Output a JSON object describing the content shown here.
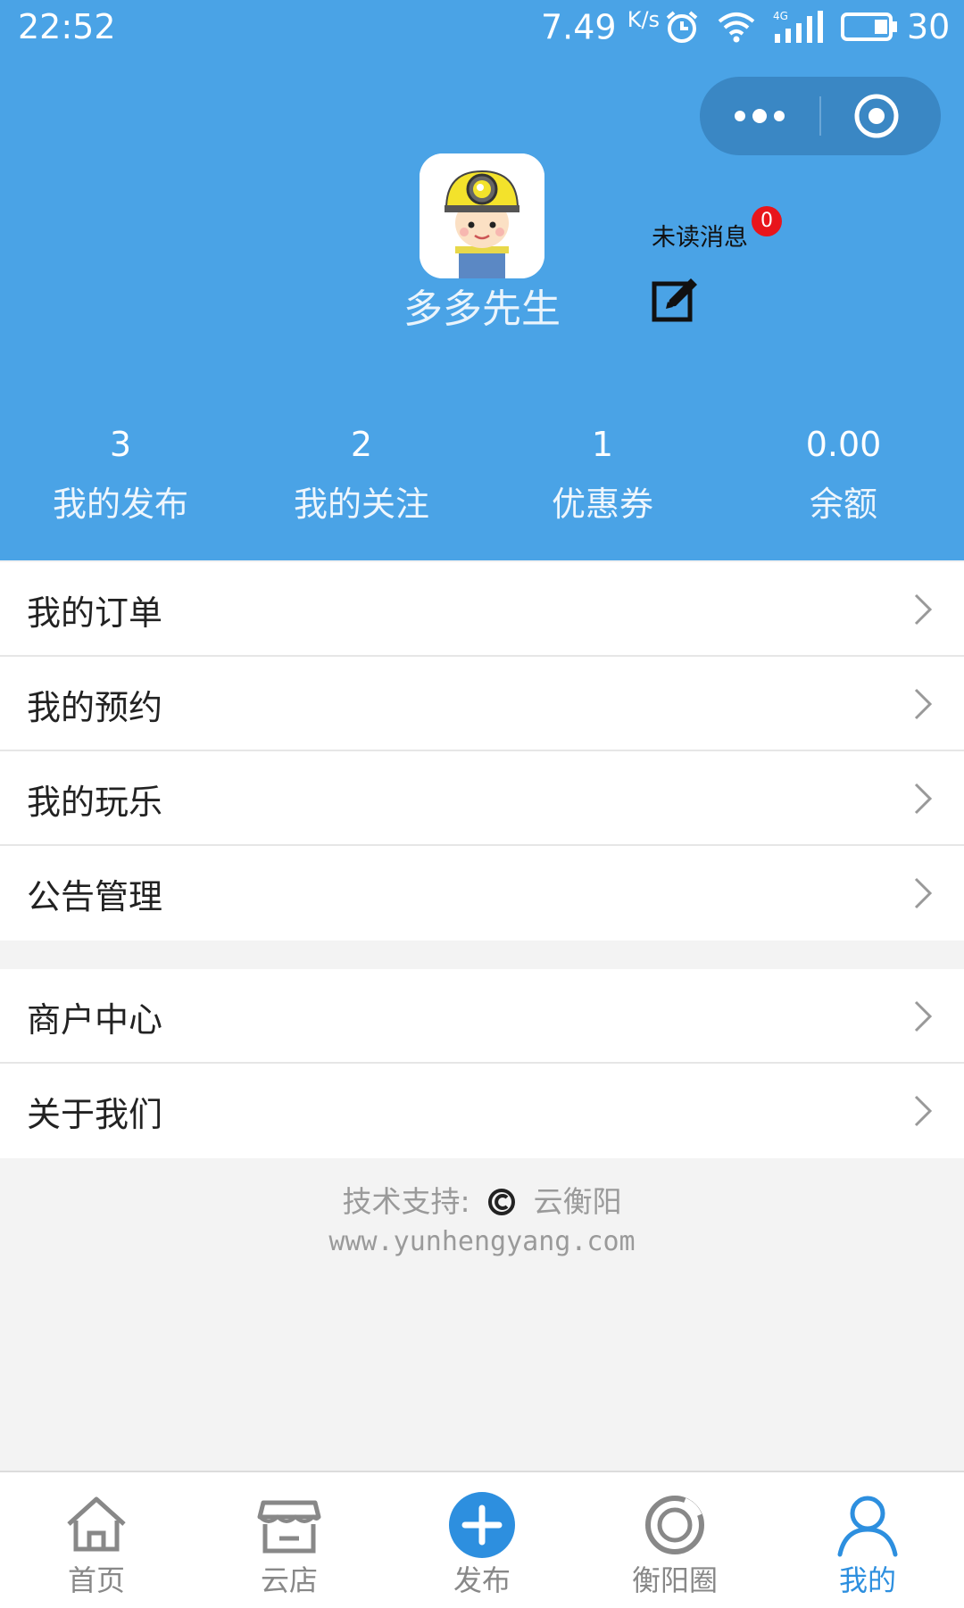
{
  "status_bar": {
    "time": "22:52",
    "speed": "7.49",
    "speed_unit": "K/s",
    "network": "4G",
    "battery": "30"
  },
  "profile": {
    "username": "多多先生",
    "unread_label": "未读消息",
    "unread_count": "0"
  },
  "stats": [
    {
      "value": "3",
      "label": "我的发布"
    },
    {
      "value": "2",
      "label": "我的关注"
    },
    {
      "value": "1",
      "label": "优惠券"
    },
    {
      "value": "0.00",
      "label": "余额"
    }
  ],
  "menu_group_1": [
    {
      "label": "我的订单"
    },
    {
      "label": "我的预约"
    },
    {
      "label": "我的玩乐"
    },
    {
      "label": "公告管理"
    }
  ],
  "menu_group_2": [
    {
      "label": "商户中心"
    },
    {
      "label": "关于我们"
    }
  ],
  "footer": {
    "tech_label": "技术支持:",
    "brand": "云衡阳",
    "url": "www.yunhengyang.com"
  },
  "tabbar": [
    {
      "label": "首页",
      "icon": "home-icon"
    },
    {
      "label": "云店",
      "icon": "store-icon"
    },
    {
      "label": "发布",
      "icon": "plus-circle-icon"
    },
    {
      "label": "衡阳圈",
      "icon": "circle-ring-icon"
    },
    {
      "label": "我的",
      "icon": "user-icon",
      "active": true
    }
  ],
  "colors": {
    "header_blue": "#4aa3e6",
    "active_tab": "#2d8fdf",
    "badge_red": "#e8151b"
  }
}
